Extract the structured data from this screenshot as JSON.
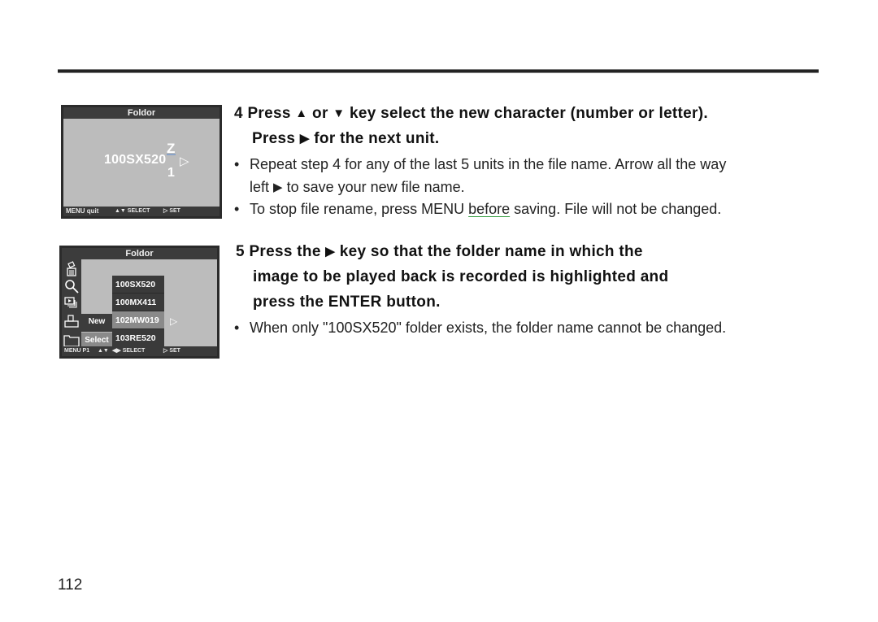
{
  "page": {
    "page_number": "112"
  },
  "screen_rename": {
    "title": "Foldor",
    "char_above": "Z",
    "filename": "100SX520",
    "char_below": "1",
    "cursor_arrow": "▷",
    "status": {
      "menu": "MENU quit",
      "select": "▲▼ SELECT",
      "set": "▷ SET"
    }
  },
  "screen_folder": {
    "title": "Foldor",
    "sidebar_icons": [
      "trash-icon",
      "magnify-icon",
      "slideshow-icon",
      "print-icon",
      "folder-icon"
    ],
    "submenu": {
      "new": "New",
      "select": "Select"
    },
    "folders": [
      "100SX520",
      "100MX411",
      "102MW019",
      "103RE520"
    ],
    "highlighted_folder": "102MW019",
    "cursor_arrow": "▷",
    "status": {
      "menu": "MENU P1",
      "updown": "▲▼",
      "select": "◀▶ SELECT",
      "set": "▷ SET"
    }
  },
  "step4": {
    "line1_a": "4 Press ",
    "up_arrow": "▲",
    "line1_b": " or ",
    "down_arrow": "▼",
    "line1_c": " key select the new character (number or letter).",
    "line2_a": "Press ",
    "right_arrow": "▶",
    "line2_b": " for the next unit.",
    "bullets": {
      "b1_line1": "Repeat step 4 for any of the last 5 units in the file name. Arrow all the way",
      "b1_line2_a": "left ",
      "b1_arrow": "▶",
      "b1_line2_b": " to save your new file name.",
      "b2_a": "To stop file rename, press MENU ",
      "b2_underlined": "before",
      "b2_b": " saving. File will not be changed."
    }
  },
  "step5": {
    "line1_a": "5  Press the ",
    "right_arrow": "▶",
    "line1_b": "  key so that the folder name in which the",
    "line2": "image to be played back is recorded is highlighted and",
    "line3": "press the ENTER button.",
    "bullet": "When only \"100SX520\" folder exists, the folder name cannot be changed."
  },
  "bullet_glyph": "•"
}
